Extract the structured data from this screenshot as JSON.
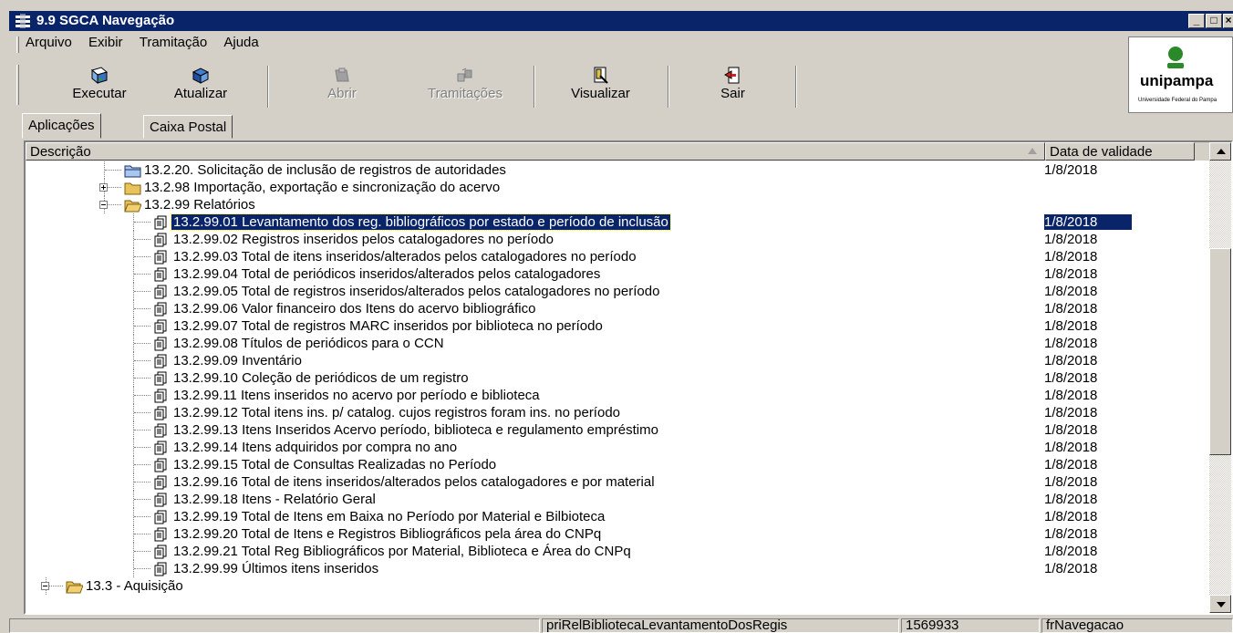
{
  "window": {
    "title": "9.9 SGCA Navegação"
  },
  "menu": [
    {
      "label": "Arquivo"
    },
    {
      "label": "Exibir"
    },
    {
      "label": "Tramitação"
    },
    {
      "label": "Ajuda"
    }
  ],
  "toolbar": {
    "executar": "Executar",
    "atualizar": "Atualizar",
    "abrir": "Abrir",
    "tramitacoes": "Tramitações",
    "visualizar": "Visualizar",
    "sair": "Sair"
  },
  "logo": {
    "text": "unipampa",
    "subtitle": "Universidade Federal do Pampa"
  },
  "tabs": {
    "aplicacoes": "Aplicações",
    "caixa_postal": "Caixa Postal"
  },
  "columns": {
    "descricao": "Descrição",
    "data": "Data de validade"
  },
  "tree": [
    {
      "text": "13.2.20. Solicitação de inclusão de registros de autoridades",
      "date": "1/8/2018",
      "level": 2,
      "icon": "folder-closed"
    },
    {
      "text": "13.2.98 Importação, exportação e sincronização do acervo",
      "date": "",
      "level": 2,
      "icon": "folder",
      "expander": "plus"
    },
    {
      "text": "13.2.99 Relatórios",
      "date": "",
      "level": 2,
      "icon": "folder-open",
      "expander": "minus"
    },
    {
      "text": "13.2.99.01 Levantamento dos reg. bibliográficos por estado e período de inclusão",
      "date": "1/8/2018",
      "level": 3,
      "icon": "report",
      "selected": true
    },
    {
      "text": "13.2.99.02 Registros inseridos pelos catalogadores no período",
      "date": "1/8/2018",
      "level": 3,
      "icon": "report"
    },
    {
      "text": "13.2.99.03 Total de itens inseridos/alterados pelos catalogadores no período",
      "date": "1/8/2018",
      "level": 3,
      "icon": "report"
    },
    {
      "text": "13.2.99.04 Total de periódicos inseridos/alterados pelos catalogadores",
      "date": "1/8/2018",
      "level": 3,
      "icon": "report"
    },
    {
      "text": "13.2.99.05 Total de registros inseridos/alterados pelos catalogadores no período",
      "date": "1/8/2018",
      "level": 3,
      "icon": "report"
    },
    {
      "text": "13.2.99.06 Valor financeiro dos Itens do acervo bibliográfico",
      "date": "1/8/2018",
      "level": 3,
      "icon": "report"
    },
    {
      "text": "13.2.99.07 Total de registros MARC inseridos por biblioteca no período",
      "date": "1/8/2018",
      "level": 3,
      "icon": "report"
    },
    {
      "text": "13.2.99.08 Títulos de periódicos para o CCN",
      "date": "1/8/2018",
      "level": 3,
      "icon": "report"
    },
    {
      "text": "13.2.99.09 Inventário",
      "date": "1/8/2018",
      "level": 3,
      "icon": "report"
    },
    {
      "text": "13.2.99.10 Coleção de periódicos de um registro",
      "date": "1/8/2018",
      "level": 3,
      "icon": "report"
    },
    {
      "text": "13.2.99.11 Itens inseridos no acervo por período e biblioteca",
      "date": "1/8/2018",
      "level": 3,
      "icon": "report"
    },
    {
      "text": "13.2.99.12 Total  itens ins. p/ catalog. cujos registros foram ins. no período",
      "date": "1/8/2018",
      "level": 3,
      "icon": "report"
    },
    {
      "text": "13.2.99.13 Itens Inseridos Acervo período, biblioteca e regulamento empréstimo",
      "date": "1/8/2018",
      "level": 3,
      "icon": "report"
    },
    {
      "text": "13.2.99.14 Itens adquiridos por compra no ano",
      "date": "1/8/2018",
      "level": 3,
      "icon": "report"
    },
    {
      "text": "13.2.99.15 Total de Consultas Realizadas no Período",
      "date": "1/8/2018",
      "level": 3,
      "icon": "report"
    },
    {
      "text": "13.2.99.16 Total de itens inseridos/alterados pelos catalogadores e por material",
      "date": "1/8/2018",
      "level": 3,
      "icon": "report"
    },
    {
      "text": "13.2.99.18 Itens - Relatório Geral",
      "date": "1/8/2018",
      "level": 3,
      "icon": "report"
    },
    {
      "text": "13.2.99.19 Total de Itens em Baixa no Período por Material e Bilbioteca",
      "date": "1/8/2018",
      "level": 3,
      "icon": "report"
    },
    {
      "text": "13.2.99.20 Total de Itens e Registros Bibliográficos pela área do CNPq",
      "date": "1/8/2018",
      "level": 3,
      "icon": "report"
    },
    {
      "text": "13.2.99.21 Total Reg Bibliográficos por Material, Biblioteca e Área do CNPq",
      "date": "1/8/2018",
      "level": 3,
      "icon": "report"
    },
    {
      "text": "13.2.99.99 Últimos itens inseridos",
      "date": "1/8/2018",
      "level": 3,
      "icon": "report"
    },
    {
      "text": "13.3 - Aquisição",
      "date": "",
      "level": 1,
      "icon": "folder-open",
      "expander": "minus"
    }
  ],
  "status": {
    "form": "priRelBibliotecaLevantamentoDosRegis",
    "code": "1569933",
    "screen": "frNavegacao"
  },
  "colors": {
    "selection": "#0a246a",
    "chrome": "#d4d0c8",
    "folder": "#e8c25a"
  }
}
